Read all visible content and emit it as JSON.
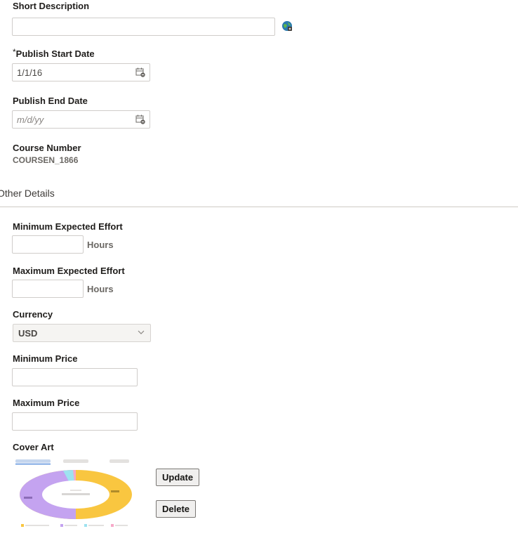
{
  "short_description": {
    "label": "Short Description",
    "value": ""
  },
  "publish_start": {
    "required_mark": "*",
    "label": "Publish Start Date",
    "value": "1/1/16"
  },
  "publish_end": {
    "label": "Publish End Date",
    "placeholder": "m/d/yy"
  },
  "course_number": {
    "label": "Course Number",
    "value": "COURSEN_1866"
  },
  "section": {
    "title": "Other Details"
  },
  "min_effort": {
    "label": "Minimum Expected Effort",
    "value": "",
    "unit": "Hours"
  },
  "max_effort": {
    "label": "Maximum Expected Effort",
    "value": "",
    "unit": "Hours"
  },
  "currency": {
    "label": "Currency",
    "value": "USD"
  },
  "min_price": {
    "label": "Minimum Price",
    "value": ""
  },
  "max_price": {
    "label": "Maximum Price",
    "value": ""
  },
  "cover_art": {
    "label": "Cover Art",
    "update_label": "Update",
    "delete_label": "Delete",
    "colors": {
      "yellow": "#f9c640",
      "purple": "#c4a3f0",
      "cyan": "#9ee2f0",
      "pink": "#f7a9c9"
    }
  },
  "colors": {
    "border": "#d0cdca",
    "divider": "#cfcac5",
    "text": "#161513",
    "muted": "#6b6864"
  }
}
